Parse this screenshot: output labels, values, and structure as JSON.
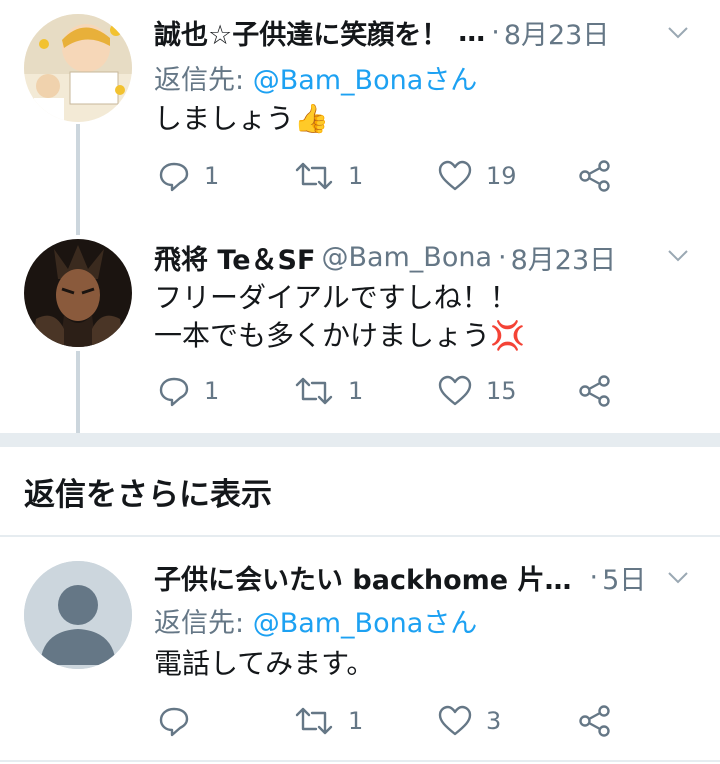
{
  "tweets": [
    {
      "display_name": "誠也☆子供達に笑顔を！",
      "handle": "",
      "ellipsis": "…",
      "dot": "·",
      "time": "8月23日",
      "reply_prefix": "返信先: ",
      "reply_mention": "@Bam_Bonaさん",
      "text_lines": [
        "しましょう👍"
      ],
      "reply_count": "1",
      "retweet_count": "1",
      "like_count": "19"
    },
    {
      "display_name": "飛将 Te＆SF",
      "handle": "@Bam_Bona",
      "ellipsis": "",
      "dot": "·",
      "time": "8月23日",
      "reply_prefix": "",
      "reply_mention": "",
      "text_lines": [
        "フリーダイアルですしね！！",
        "一本でも多くかけましょう💢"
      ],
      "reply_count": "1",
      "retweet_count": "1",
      "like_count": "15"
    },
    {
      "display_name": "子供に会いたい backhome 片…",
      "handle": "",
      "ellipsis": "",
      "dot": "·",
      "time": "5日",
      "reply_prefix": "返信先: ",
      "reply_mention": "@Bam_Bonaさん",
      "text_lines": [
        "電話してみます。"
      ],
      "reply_count": "",
      "retweet_count": "1",
      "like_count": "3"
    }
  ],
  "more_replies_label": "返信をさらに表示",
  "icons": {
    "reply": "reply-icon",
    "retweet": "retweet-icon",
    "like": "heart-icon",
    "share": "share-icon",
    "menu": "chevron-down-icon"
  },
  "colors": {
    "accent": "#1da1f2",
    "muted": "#657786",
    "text": "#14171a",
    "divider": "#e6ecf0",
    "thread": "#ccd6dd"
  }
}
